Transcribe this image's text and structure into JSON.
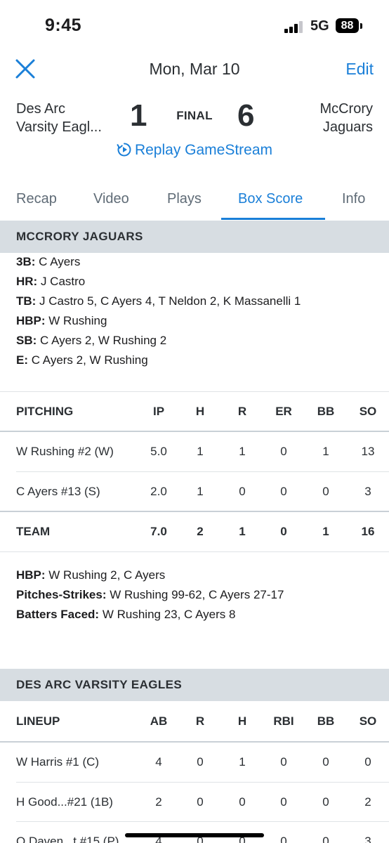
{
  "status_bar": {
    "time": "9:45",
    "network": "5G",
    "battery": "88"
  },
  "header": {
    "date": "Mon, Mar 10",
    "edit_label": "Edit"
  },
  "game": {
    "away_team": "Des Arc\nVarsity Eagl...",
    "away_line1": "Des Arc",
    "away_line2": "Varsity Eagl...",
    "away_score": "1",
    "status": "FINAL",
    "home_score": "6",
    "home_line1": "McCrory",
    "home_line2": "Jaguars",
    "replay_label": "Replay GameStream"
  },
  "tabs": [
    {
      "label": "Recap"
    },
    {
      "label": "Video"
    },
    {
      "label": "Plays"
    },
    {
      "label": "Box Score",
      "active": true
    },
    {
      "label": "Info"
    }
  ],
  "jaguars": {
    "header": "MCCRORY JAGUARS",
    "batting_notes": [
      {
        "key": "3B:",
        "value": " C Ayers"
      },
      {
        "key": "HR:",
        "value": " J Castro"
      },
      {
        "key": "TB:",
        "value": " J Castro 5, C Ayers 4, T Neldon 2, K Massanelli 1"
      },
      {
        "key": "HBP:",
        "value": " W Rushing"
      },
      {
        "key": "SB:",
        "value": " C Ayers 2, W Rushing 2"
      },
      {
        "key": "E:",
        "value": " C Ayers 2, W Rushing"
      }
    ],
    "pitching": {
      "columns": [
        "PITCHING",
        "IP",
        "H",
        "R",
        "ER",
        "BB",
        "SO"
      ],
      "rows": [
        [
          "W Rushing #2 (W)",
          "5.0",
          "1",
          "1",
          "0",
          "1",
          "13"
        ],
        [
          "C Ayers #13 (S)",
          "2.0",
          "1",
          "0",
          "0",
          "0",
          "3"
        ]
      ],
      "total": [
        "TEAM",
        "7.0",
        "2",
        "1",
        "0",
        "1",
        "16"
      ]
    },
    "pitching_notes": [
      {
        "key": "HBP:",
        "value": " W Rushing 2, C Ayers"
      },
      {
        "key": "Pitches-Strikes:",
        "value": " W Rushing 99-62, C Ayers 27-17"
      },
      {
        "key": "Batters Faced:",
        "value": " W Rushing 23, C Ayers 8"
      }
    ]
  },
  "eagles": {
    "header": "DES ARC VARSITY EAGLES",
    "lineup": {
      "columns": [
        "LINEUP",
        "AB",
        "R",
        "H",
        "RBI",
        "BB",
        "SO"
      ],
      "rows": [
        [
          "W Harris #1 (C)",
          "4",
          "0",
          "1",
          "0",
          "0",
          "0"
        ],
        [
          "H Good...#21 (1B)",
          "2",
          "0",
          "0",
          "0",
          "0",
          "2"
        ],
        [
          "Q Daven...t #15 (P)",
          "4",
          "0",
          "0",
          "0",
          "0",
          "3"
        ]
      ]
    }
  },
  "colors": {
    "accent": "#1a7fd8",
    "section_bg": "#d7dde2",
    "text": "#2b2f33"
  }
}
